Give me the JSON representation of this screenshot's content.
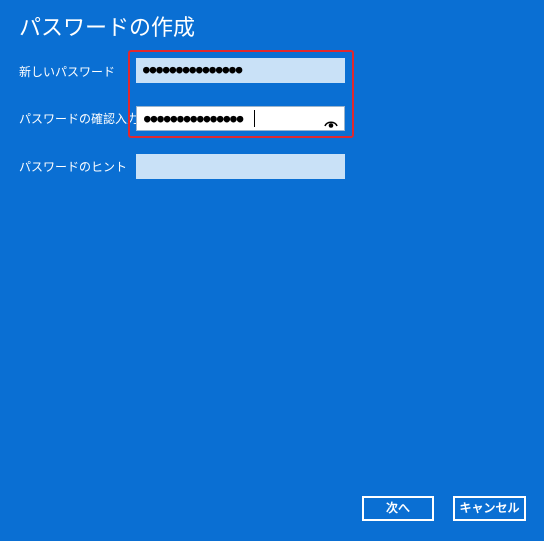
{
  "title": "パスワードの作成",
  "fields": {
    "new_password": {
      "label": "新しいパスワード",
      "value": "●●●●●●●●●●●●●●●"
    },
    "confirm_password": {
      "label": "パスワードの確認入力",
      "value": "●●●●●●●●●●●●●●●",
      "reveal_icon": "eye-icon"
    },
    "hint": {
      "label": "パスワードのヒント",
      "value": ""
    }
  },
  "buttons": {
    "next": "次へ",
    "cancel": "キャンセル"
  },
  "colors": {
    "background": "#0a6fd3",
    "highlight": "#e0282e",
    "field_inactive": "#c9e1f7"
  }
}
